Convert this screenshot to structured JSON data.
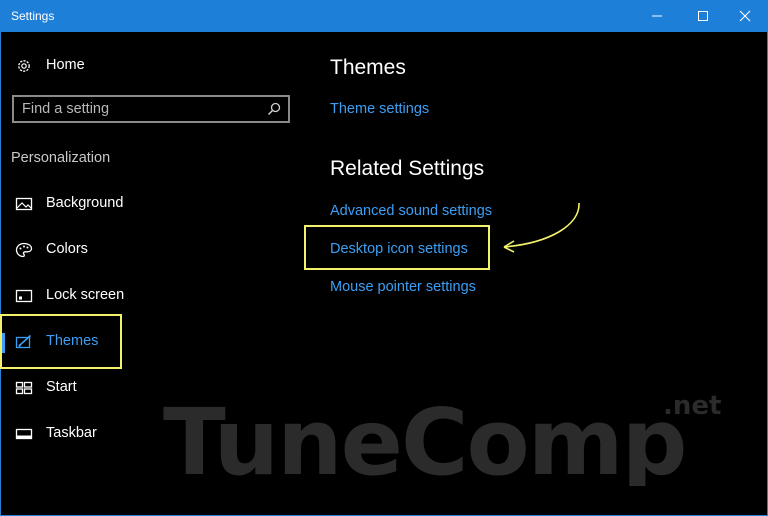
{
  "window": {
    "title": "Settings"
  },
  "sidebar": {
    "home_label": "Home",
    "search_placeholder": "Find a setting",
    "section_label": "Personalization",
    "items": [
      {
        "label": "Background",
        "icon": "image-icon"
      },
      {
        "label": "Colors",
        "icon": "palette-icon"
      },
      {
        "label": "Lock screen",
        "icon": "lock-screen-icon"
      },
      {
        "label": "Themes",
        "icon": "themes-icon",
        "selected": true
      },
      {
        "label": "Start",
        "icon": "start-icon"
      },
      {
        "label": "Taskbar",
        "icon": "taskbar-icon"
      }
    ]
  },
  "main": {
    "themes_heading": "Themes",
    "theme_settings_link": "Theme settings",
    "related_heading": "Related Settings",
    "related_links": [
      "Advanced sound settings",
      "Desktop icon settings",
      "Mouse pointer settings"
    ]
  },
  "watermark": {
    "text": "TuneComp",
    "suffix": ".net"
  },
  "colors": {
    "titlebar": "#1e7fd8",
    "accent": "#3b9ff5",
    "highlight": "#f4f26b",
    "background": "#000000"
  }
}
